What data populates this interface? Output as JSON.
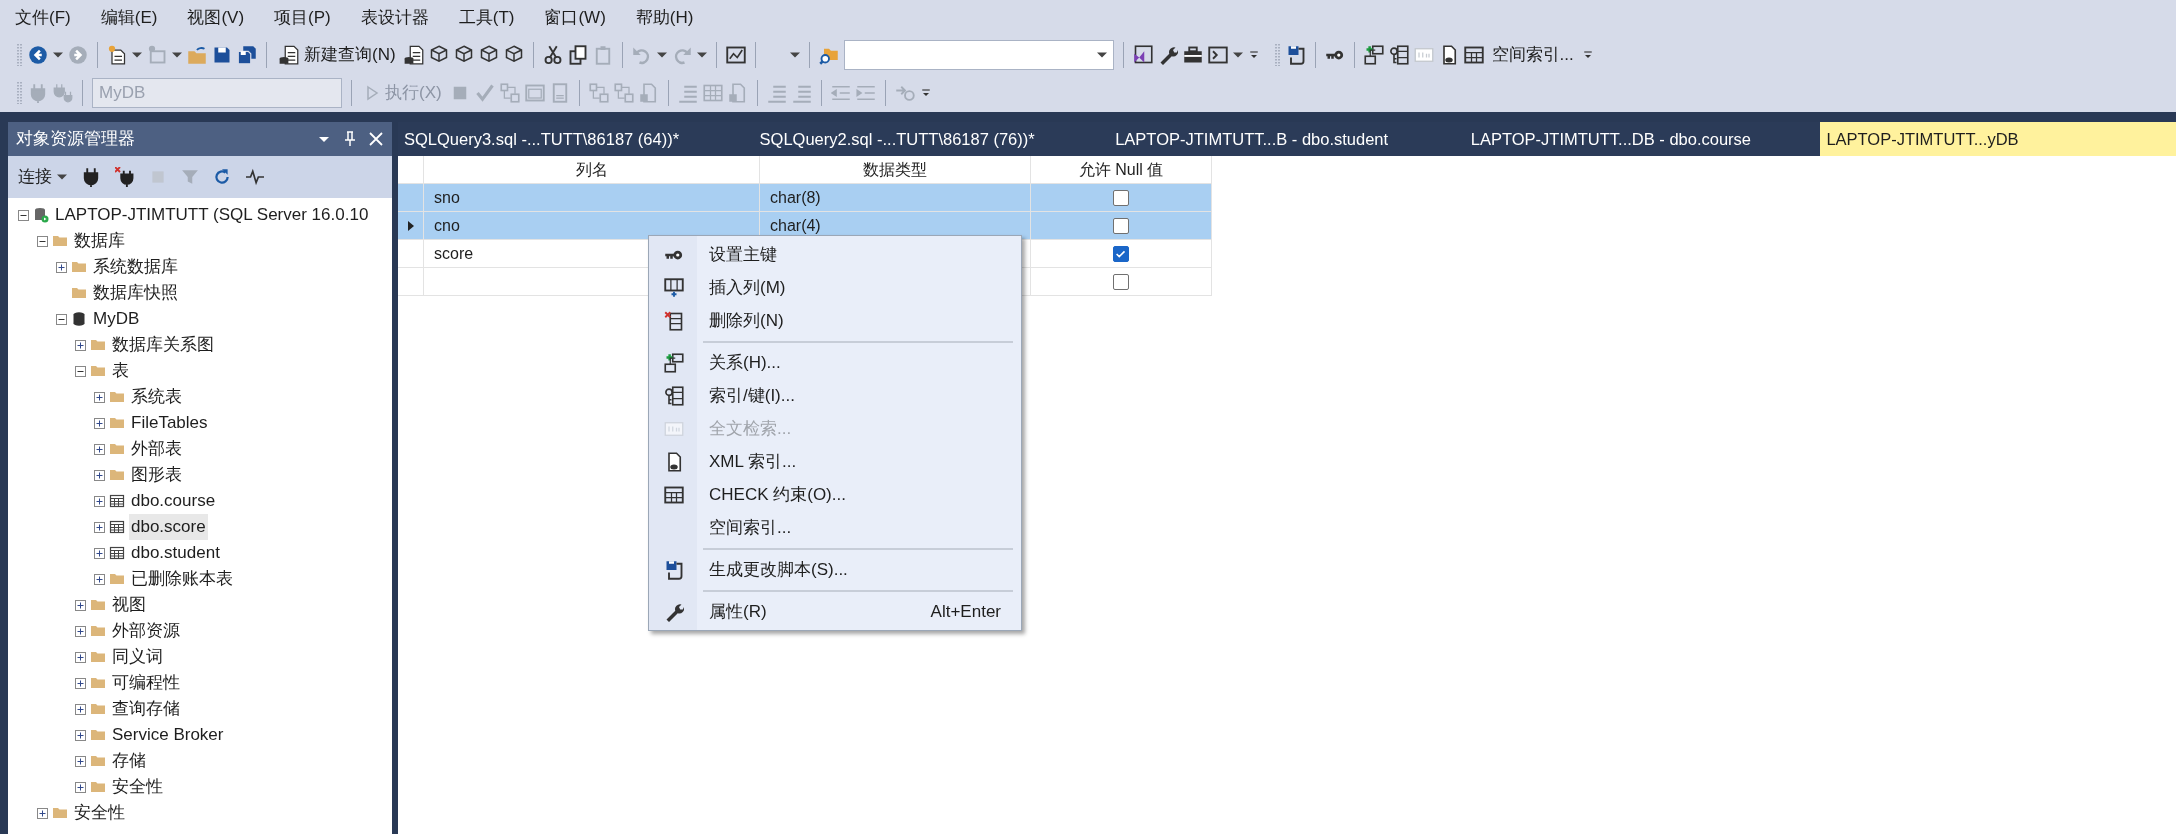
{
  "menu_bar": [
    "文件(F)",
    "编辑(E)",
    "视图(V)",
    "项目(P)",
    "表设计器",
    "工具(T)",
    "窗口(W)",
    "帮助(H)"
  ],
  "toolbar": {
    "new_query": "新建查询(N)",
    "spatial_index": "空间索引...",
    "database": {
      "value": "MyDB",
      "disabled": true
    },
    "execute": {
      "label": "执行(X)",
      "disabled": true
    }
  },
  "object_explorer": {
    "title": "对象资源管理器",
    "connect": "连接",
    "tree": [
      {
        "label": "LAPTOP-JTIMTUTT (SQL Server 16.0.10",
        "kind": "server",
        "expanded": true,
        "selected": false,
        "children": [
          {
            "label": "数据库",
            "kind": "folder",
            "expanded": true,
            "selected": false,
            "children": [
              {
                "label": "系统数据库",
                "kind": "folder",
                "expanded": false,
                "selected": false
              },
              {
                "label": "数据库快照",
                "kind": "folder",
                "expandable": false,
                "selected": false
              },
              {
                "label": "MyDB",
                "kind": "database",
                "expanded": true,
                "selected": false,
                "children": [
                  {
                    "label": "数据库关系图",
                    "kind": "folder",
                    "expanded": false,
                    "selected": false
                  },
                  {
                    "label": "表",
                    "kind": "folder",
                    "expanded": true,
                    "selected": false,
                    "children": [
                      {
                        "label": "系统表",
                        "kind": "folder",
                        "expanded": false,
                        "selected": false
                      },
                      {
                        "label": "FileTables",
                        "kind": "folder",
                        "expanded": false,
                        "selected": false
                      },
                      {
                        "label": "外部表",
                        "kind": "folder",
                        "expanded": false,
                        "selected": false
                      },
                      {
                        "label": "图形表",
                        "kind": "folder",
                        "expanded": false,
                        "selected": false
                      },
                      {
                        "label": "dbo.course",
                        "kind": "table",
                        "expanded": false,
                        "selected": false
                      },
                      {
                        "label": "dbo.score",
                        "kind": "table",
                        "expanded": false,
                        "selected": true
                      },
                      {
                        "label": "dbo.student",
                        "kind": "table",
                        "expanded": false,
                        "selected": false
                      },
                      {
                        "label": "已删除账本表",
                        "kind": "folder",
                        "expanded": false,
                        "selected": false
                      }
                    ]
                  },
                  {
                    "label": "视图",
                    "kind": "folder",
                    "expanded": false,
                    "selected": false
                  },
                  {
                    "label": "外部资源",
                    "kind": "folder",
                    "expanded": false,
                    "selected": false
                  },
                  {
                    "label": "同义词",
                    "kind": "folder",
                    "expanded": false,
                    "selected": false
                  },
                  {
                    "label": "可编程性",
                    "kind": "folder",
                    "expanded": false,
                    "selected": false
                  },
                  {
                    "label": "查询存储",
                    "kind": "folder",
                    "expanded": false,
                    "selected": false
                  },
                  {
                    "label": "Service Broker",
                    "kind": "folder",
                    "expanded": false,
                    "selected": false
                  },
                  {
                    "label": "存储",
                    "kind": "folder",
                    "expanded": false,
                    "selected": false
                  },
                  {
                    "label": "安全性",
                    "kind": "folder",
                    "expanded": false,
                    "selected": false
                  }
                ]
              }
            ]
          },
          {
            "label": "安全性",
            "kind": "folder",
            "expanded": false,
            "selected": false
          }
        ]
      }
    ]
  },
  "tabs": [
    {
      "label": "SQLQuery3.sql -...TUTT\\86187 (64))*",
      "selected": false
    },
    {
      "label": "SQLQuery2.sql -...TUTT\\86187 (76))*",
      "selected": false
    },
    {
      "label": "LAPTOP-JTIMTUTT...B - dbo.student",
      "selected": false
    },
    {
      "label": "LAPTOP-JTIMTUTT...DB - dbo.course",
      "selected": false
    },
    {
      "label": "LAPTOP-JTIMTUTT...yDB",
      "selected": true
    }
  ],
  "grid": {
    "columns": [
      "列名",
      "数据类型",
      "允许 Null 值"
    ],
    "rows": [
      {
        "name": "sno",
        "type": "char(8)",
        "allow_null": false,
        "selected": true,
        "current": false
      },
      {
        "name": "cno",
        "type": "char(4)",
        "allow_null": false,
        "selected": true,
        "current": true
      },
      {
        "name": "score",
        "allow_null": true,
        "selected": false,
        "current": false
      },
      {
        "allow_null": false,
        "selected": false,
        "current": false
      }
    ]
  },
  "context_menu": [
    {
      "kind": "item",
      "label": "设置主键",
      "disabled": false
    },
    {
      "kind": "item",
      "label": "插入列(M)",
      "disabled": false
    },
    {
      "kind": "item",
      "label": "删除列(N)",
      "disabled": false
    },
    {
      "kind": "separator"
    },
    {
      "kind": "item",
      "label": "关系(H)...",
      "disabled": false
    },
    {
      "kind": "item",
      "label": "索引/键(I)...",
      "disabled": false
    },
    {
      "kind": "item",
      "label": "全文检索...",
      "disabled": true
    },
    {
      "kind": "item",
      "label": "XML 索引...",
      "disabled": false
    },
    {
      "kind": "item",
      "label": "CHECK 约束(O)...",
      "disabled": false
    },
    {
      "kind": "item",
      "label": "空间索引...",
      "disabled": false
    },
    {
      "kind": "separator"
    },
    {
      "kind": "item",
      "label": "生成更改脚本(S)...",
      "disabled": false
    },
    {
      "kind": "separator"
    },
    {
      "kind": "item",
      "label": "属性(R)",
      "shortcut": "Alt+Enter",
      "disabled": false
    }
  ]
}
